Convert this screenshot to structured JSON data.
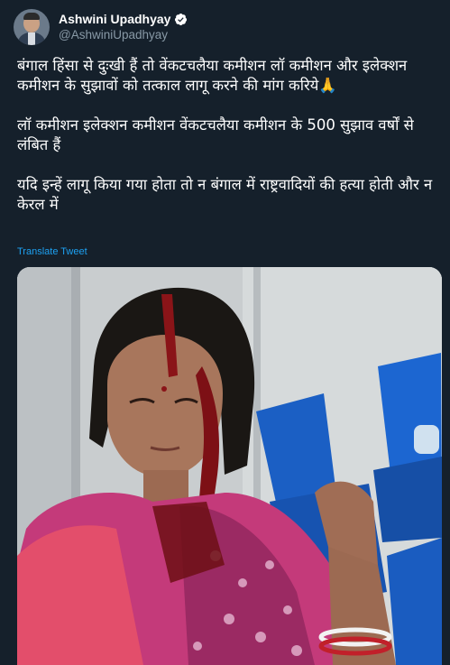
{
  "author": {
    "display_name": "Ashwini Upadhyay",
    "handle": "@AshwiniUpadhyay",
    "verified": true
  },
  "tweet": {
    "paragraphs": [
      "बंगाल हिंसा से दुःखी हैं तो वेंकटचलैया कमीशन लॉ कमीशन और इलेक्शन कमीशन के सुझावों को तत्काल लागू करने की मांग करिये🙏",
      "लॉ कमीशन इलेक्शन कमीशन वेंकटचलैया कमीशन के 500 सुझाव वर्षों से लंबित हैं",
      "यदि इन्हें लागू किया गया होता तो न बंगाल में राष्ट्रवादियों की हत्या होती और न केरल में"
    ],
    "translate_label": "Translate Tweet"
  },
  "media": {
    "type": "photo",
    "subject": "injured-woman-photo"
  },
  "colors": {
    "background": "#15202b",
    "link": "#1da1f2",
    "secondary_text": "#8899a6",
    "verified_badge": "#ffffff"
  }
}
